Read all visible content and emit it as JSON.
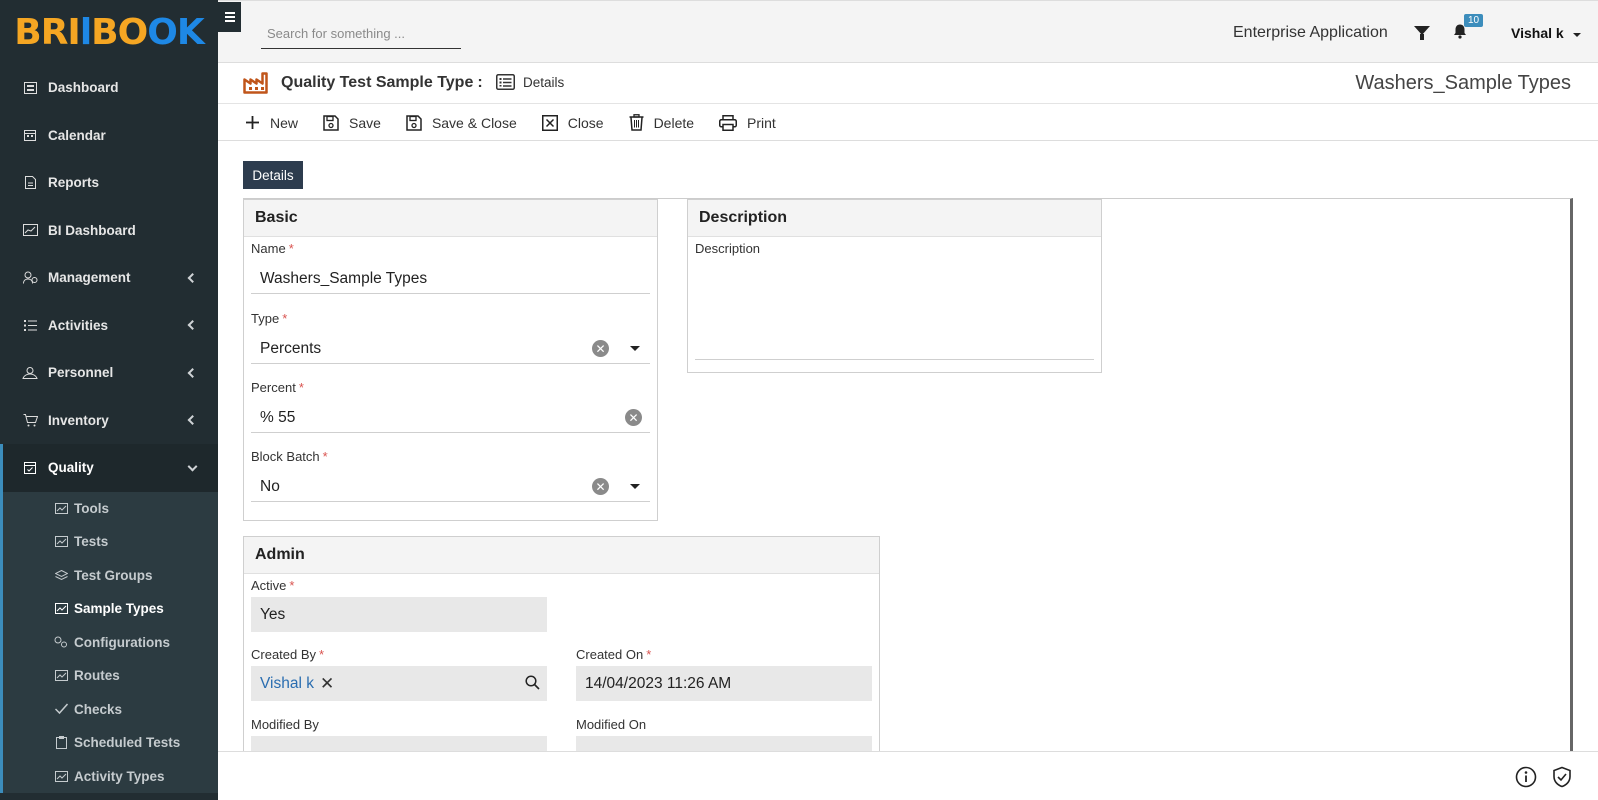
{
  "app": {
    "logo": {
      "part1": "BRI",
      "part2": "l",
      "part3": "BO",
      "part4": "OK"
    },
    "app_name": "Enterprise Application",
    "user_name": "Vishal k",
    "notification_count": "10",
    "search_placeholder": "Search for something ..."
  },
  "sidebar": {
    "items": [
      {
        "label": "Dashboard",
        "icon": "dashboard-icon"
      },
      {
        "label": "Calendar",
        "icon": "calendar-icon"
      },
      {
        "label": "Reports",
        "icon": "report-icon"
      },
      {
        "label": "BI Dashboard",
        "icon": "bi-chart-icon"
      },
      {
        "label": "Management",
        "icon": "management-icon"
      },
      {
        "label": "Activities",
        "icon": "list-icon"
      },
      {
        "label": "Personnel",
        "icon": "personnel-icon"
      },
      {
        "label": "Inventory",
        "icon": "inventory-icon"
      },
      {
        "label": "Quality",
        "icon": "quality-icon"
      }
    ],
    "quality_submenu": [
      {
        "label": "Tools"
      },
      {
        "label": "Tests"
      },
      {
        "label": "Test Groups"
      },
      {
        "label": "Sample Types"
      },
      {
        "label": "Configurations"
      },
      {
        "label": "Routes"
      },
      {
        "label": "Checks"
      },
      {
        "label": "Scheduled Tests"
      },
      {
        "label": "Activity Types"
      }
    ]
  },
  "header": {
    "page_title": "Quality Test Sample Type",
    "colon": ":",
    "crumb": "Details",
    "record_title": "Washers_Sample Types"
  },
  "toolbar": {
    "new": "New",
    "save": "Save",
    "save_close": "Save & Close",
    "close": "Close",
    "delete": "Delete",
    "print": "Print"
  },
  "tabs": {
    "details": "Details"
  },
  "basic": {
    "title": "Basic",
    "name_label": "Name",
    "name_value": "Washers_Sample Types",
    "type_label": "Type",
    "type_value": "Percents",
    "percent_label": "Percent",
    "percent_value": "% 55",
    "block_label": "Block Batch",
    "block_value": "No",
    "required_mark": "*"
  },
  "description": {
    "title": "Description",
    "field_label": "Description",
    "field_value": ""
  },
  "admin": {
    "title": "Admin",
    "active_label": "Active",
    "active_value": "Yes",
    "created_by_label": "Created By",
    "created_by_value": "Vishal k",
    "created_on_label": "Created On",
    "created_on_value": "14/04/2023 11:26 AM",
    "modified_by_label": "Modified By",
    "modified_on_label": "Modified On"
  },
  "colors": {
    "sidebar_bg": "#222d32",
    "accent": "#3c8dbc",
    "tab_bg": "#2d3c4e",
    "required": "#d9534f",
    "title_icon": "#c0551a"
  }
}
